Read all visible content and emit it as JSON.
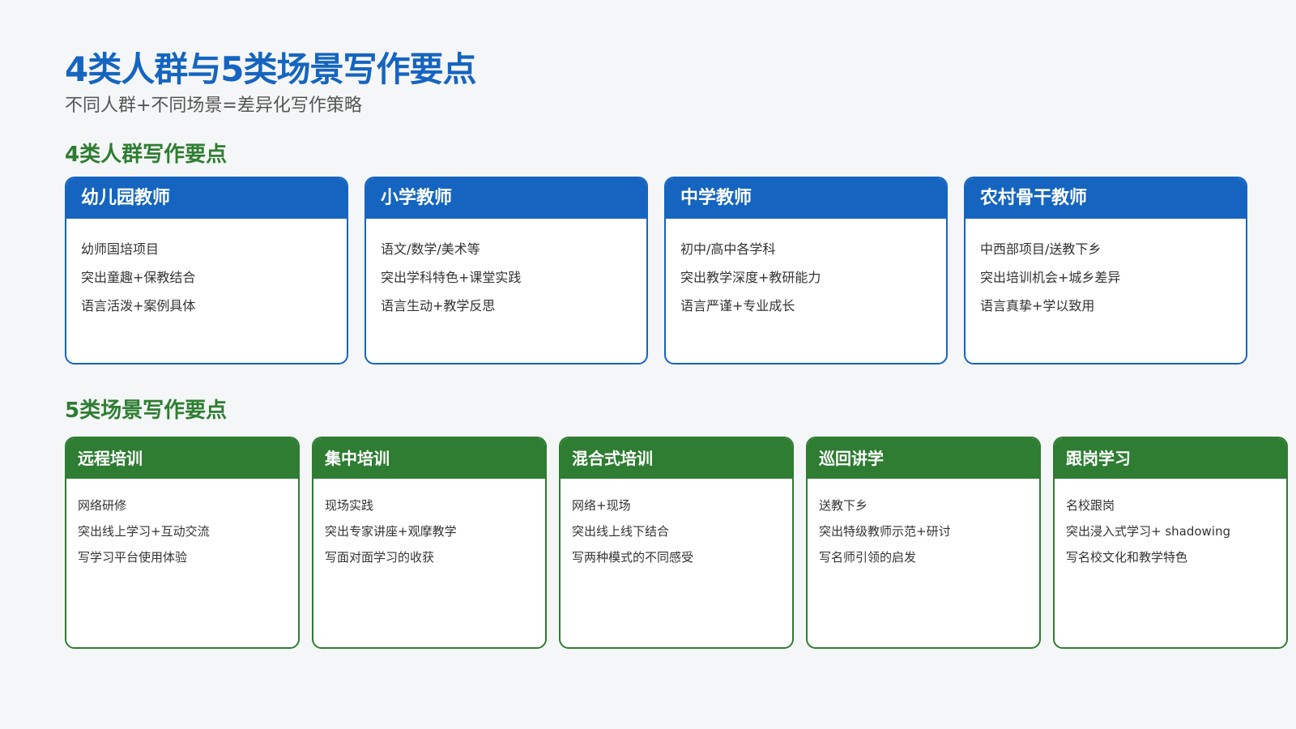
{
  "slide": {
    "title": "4类人群与5类场景写作要点",
    "subtitle": "不同人群+不同场景=差异化写作策略"
  },
  "groups": {
    "title": "4类人群写作要点",
    "cards": [
      {
        "header": "幼儿园教师",
        "lines": [
          "幼师国培项目",
          "突出童趣+保教结合",
          "语言活泼+案例具体"
        ]
      },
      {
        "header": "小学教师",
        "lines": [
          "语文/数学/美术等",
          "突出学科特色+课堂实践",
          "语言生动+教学反思"
        ]
      },
      {
        "header": "中学教师",
        "lines": [
          "初中/高中各学科",
          "突出教学深度+教研能力",
          "语言严谨+专业成长"
        ]
      },
      {
        "header": "农村骨干教师",
        "lines": [
          "中西部项目/送教下乡",
          "突出培训机会+城乡差异",
          "语言真挚+学以致用"
        ]
      }
    ]
  },
  "scenes": {
    "title": "5类场景写作要点",
    "cards": [
      {
        "header": "远程培训",
        "lines": [
          "网络研修",
          "突出线上学习+互动交流",
          "写学习平台使用体验"
        ]
      },
      {
        "header": "集中培训",
        "lines": [
          "现场实践",
          "突出专家讲座+观摩教学",
          "写面对面学习的收获"
        ]
      },
      {
        "header": "混合式培训",
        "lines": [
          "网络+现场",
          "突出线上线下结合",
          "写两种模式的不同感受"
        ]
      },
      {
        "header": "巡回讲学",
        "lines": [
          "送教下乡",
          "突出特级教师示范+研讨",
          "写名师引领的启发"
        ]
      },
      {
        "header": "跟岗学习",
        "lines": [
          "名校跟岗",
          "突出浸入式学习+ shadowing",
          "写名校文化和教学特色"
        ]
      }
    ]
  },
  "colors": {
    "primary_blue": "#1565c0",
    "primary_green": "#2e7d32",
    "background": "#f5f6f7"
  }
}
